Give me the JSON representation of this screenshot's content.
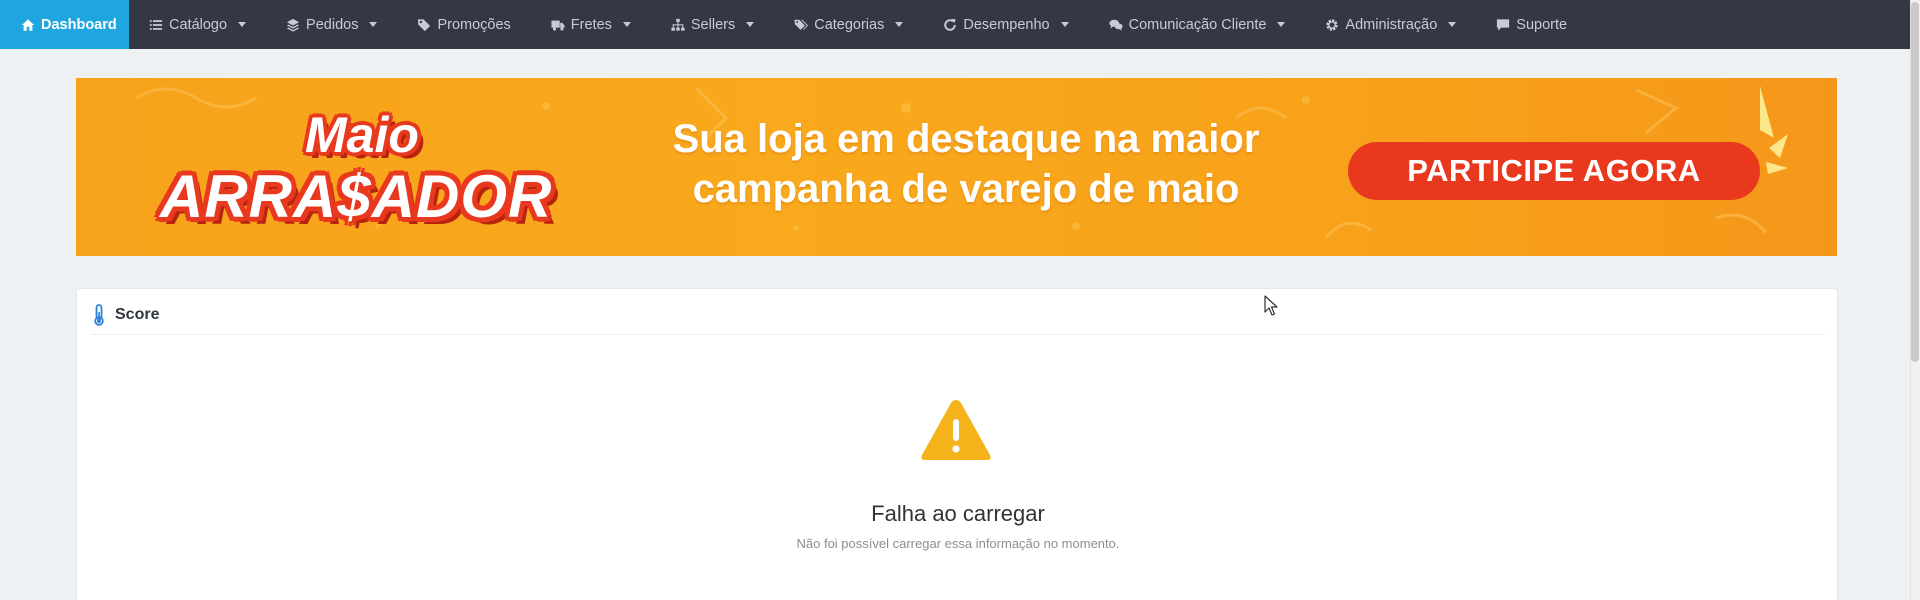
{
  "nav": {
    "items": [
      {
        "label": "Dashboard",
        "icon": "home-icon",
        "active": true,
        "dropdown": false
      },
      {
        "label": "Catálogo",
        "icon": "list-icon",
        "active": false,
        "dropdown": true
      },
      {
        "label": "Pedidos",
        "icon": "layers-icon",
        "active": false,
        "dropdown": true
      },
      {
        "label": "Promoções",
        "icon": "tag-icon",
        "active": false,
        "dropdown": false
      },
      {
        "label": "Fretes",
        "icon": "truck-icon",
        "active": false,
        "dropdown": true
      },
      {
        "label": "Sellers",
        "icon": "sitemap-icon",
        "active": false,
        "dropdown": true
      },
      {
        "label": "Categorias",
        "icon": "tags-icon",
        "active": false,
        "dropdown": true
      },
      {
        "label": "Desempenho",
        "icon": "refresh-icon",
        "active": false,
        "dropdown": true
      },
      {
        "label": "Comunicação Cliente",
        "icon": "chat-icon",
        "active": false,
        "dropdown": true
      },
      {
        "label": "Administração",
        "icon": "gear-icon",
        "active": false,
        "dropdown": true
      },
      {
        "label": "Suporte",
        "icon": "message-icon",
        "active": false,
        "dropdown": false
      }
    ],
    "colors": {
      "background": "#333844",
      "active": "#1fa6e0",
      "text": "#c7ccd4"
    }
  },
  "banner": {
    "logo_line1": "Maio",
    "logo_line2": "ARRA$ADOR",
    "headline_line1": "Sua loja em destaque na maior",
    "headline_line2": "campanha de varejo de maio",
    "cta_label": "PARTICIPE AGORA",
    "colors": {
      "background": "#f9a91c",
      "accent": "#e8391f"
    }
  },
  "score_card": {
    "title": "Score",
    "title_icon": "thermometer-icon",
    "status_icon": "warning-icon",
    "error_title": "Falha ao carregar",
    "error_message": "Não foi possível carregar essa informação no momento.",
    "colors": {
      "warning": "#f5b21b"
    }
  }
}
